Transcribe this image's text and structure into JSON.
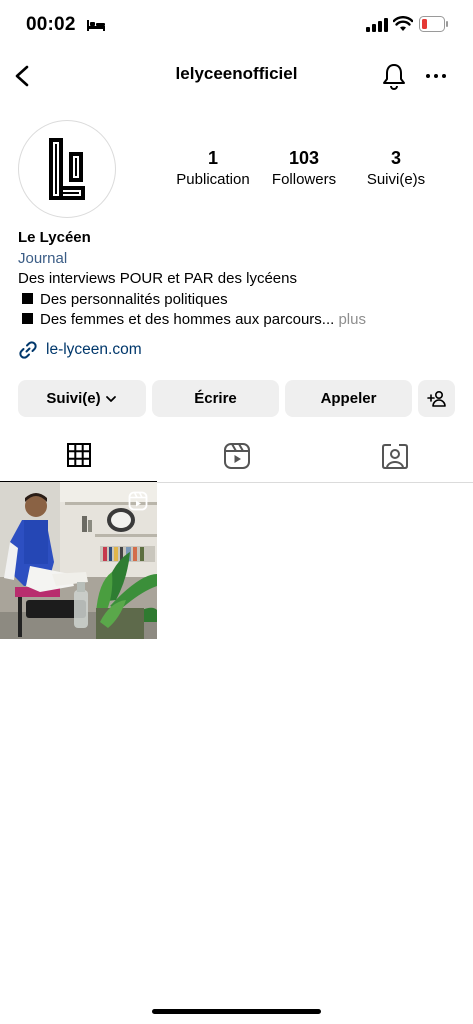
{
  "status_bar": {
    "time": "00:02"
  },
  "header": {
    "username": "lelyceenofficiel"
  },
  "stats": [
    {
      "value": "1",
      "label": "Publication"
    },
    {
      "value": "103",
      "label": "Followers"
    },
    {
      "value": "3",
      "label": "Suivi(e)s"
    }
  ],
  "bio": {
    "name": "Le Lycéen",
    "category": "Journal",
    "line1": "Des interviews POUR et PAR des lycéens",
    "line2": "Des personnalités politiques",
    "line3": "Des femmes et des hommes aux parcours...",
    "more": "plus",
    "link": "le-lyceen.com"
  },
  "buttons": {
    "follow": "Suivi(e)",
    "write": "Écrire",
    "call": "Appeler"
  },
  "icons": [
    "bed-icon",
    "signal-icon",
    "wifi-icon",
    "battery-icon",
    "back-icon",
    "bell-icon",
    "more-icon",
    "link-icon",
    "chevron-down-icon",
    "add-person-icon",
    "grid-icon",
    "reels-icon",
    "tagged-icon",
    "reel-badge-icon"
  ],
  "colors": {
    "link": "#00376b",
    "category": "#3b5d86",
    "button_bg": "#efefef",
    "battery_low": "#e53935"
  }
}
